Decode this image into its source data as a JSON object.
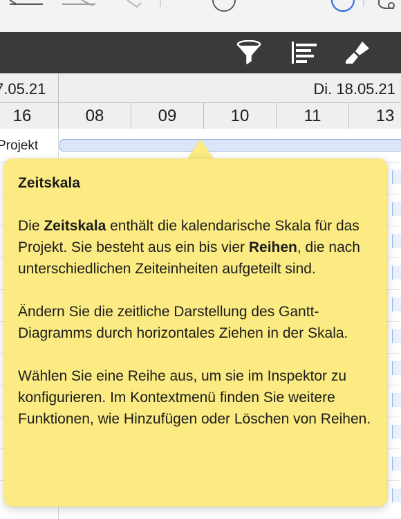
{
  "toolbar": {
    "icons": [
      "filter-funnel-icon",
      "outline-align-icon",
      "brush-style-icon"
    ]
  },
  "timescale": {
    "date_left": "7.05.21",
    "date_right": "Di. 18.05.21",
    "hours": [
      "16",
      "08",
      "09",
      "10",
      "11",
      "13"
    ]
  },
  "rows": {
    "first_label": "Projekt"
  },
  "tooltip": {
    "title": "Zeitskala",
    "p1_a": "Die ",
    "p1_bold": "Zeitskala",
    "p1_b": " enthält die kalendarische Skala für das Projekt. Sie besteht aus ein bis vier ",
    "p1_bold2": "Reihen",
    "p1_c": ", die nach unterschiedlichen Zeiteinheiten aufgeteilt sind.",
    "p2": "Ändern Sie die zeitliche Darstellung des Gantt-Diagramms durch horizontales Ziehen in der Skala.",
    "p3": "Wählen Sie eine Reihe aus, um sie im Inspektor zu konfigurieren. Im Kontextmenü finden Sie weitere Funktionen, wie Hinzufügen oder Löschen von Reihen."
  },
  "colors": {
    "tooltip_bg": "#fbeb82",
    "toolbar_dark": "#3a3a3c",
    "accent_blue": "#2f6fe0"
  }
}
